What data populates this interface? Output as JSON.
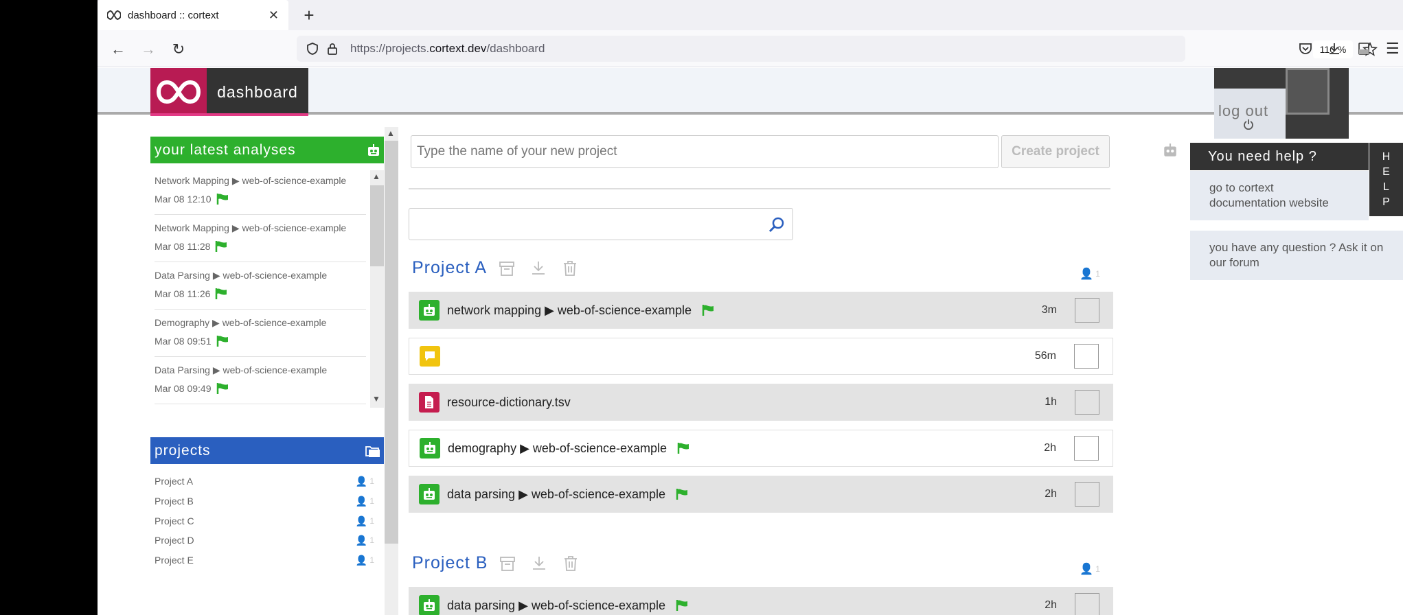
{
  "browser": {
    "tab_title": "dashboard :: cortext",
    "url_prefix": "https://projects.",
    "url_domain": "cortext.dev",
    "url_path": "/dashboard",
    "zoom": "110 %"
  },
  "header": {
    "app_name": "dashboard",
    "logout_label": "log out"
  },
  "latest": {
    "title": "your latest analyses",
    "items": [
      {
        "title": "Network Mapping ▶ web-of-science-example",
        "date": "Mar 08 12:10"
      },
      {
        "title": "Network Mapping ▶ web-of-science-example",
        "date": "Mar 08 11:28"
      },
      {
        "title": "Data Parsing ▶ web-of-science-example",
        "date": "Mar 08 11:26"
      },
      {
        "title": "Demography ▶ web-of-science-example",
        "date": "Mar 08 09:51"
      },
      {
        "title": "Data Parsing ▶ web-of-science-example",
        "date": "Mar 08 09:49"
      }
    ]
  },
  "projects": {
    "title": "projects",
    "items": [
      {
        "name": "Project A",
        "users": "1"
      },
      {
        "name": "Project B",
        "users": "1"
      },
      {
        "name": "Project C",
        "users": "1"
      },
      {
        "name": "Project D",
        "users": "1"
      },
      {
        "name": "Project E",
        "users": "1"
      }
    ]
  },
  "main": {
    "new_project_placeholder": "Type the name of your new project",
    "create_label": "Create project",
    "project_a": {
      "title": "Project A",
      "users": "1",
      "rows": [
        {
          "type": "bot",
          "name": "network mapping ▶ web-of-science-example",
          "age": "3m"
        },
        {
          "type": "note",
          "name": "",
          "age": "56m"
        },
        {
          "type": "file",
          "name": "resource-dictionary.tsv",
          "age": "1h"
        },
        {
          "type": "bot",
          "name": "demography ▶ web-of-science-example",
          "age": "2h"
        },
        {
          "type": "bot",
          "name": "data parsing ▶ web-of-science-example",
          "age": "2h"
        }
      ]
    },
    "project_b": {
      "title": "Project B",
      "users": "1",
      "rows": [
        {
          "type": "bot",
          "name": "data parsing ▶ web-of-science-example",
          "age": "2h"
        }
      ]
    }
  },
  "help": {
    "title": "You need help ?",
    "tab_letters": [
      "H",
      "E",
      "L",
      "P"
    ],
    "doc_link": "go to cortext documentation website",
    "forum_link": "you have any question ? Ask it on our forum"
  },
  "colors": {
    "green": "#2db02d",
    "blue": "#2a5fbf",
    "brand": "#b81b53"
  }
}
